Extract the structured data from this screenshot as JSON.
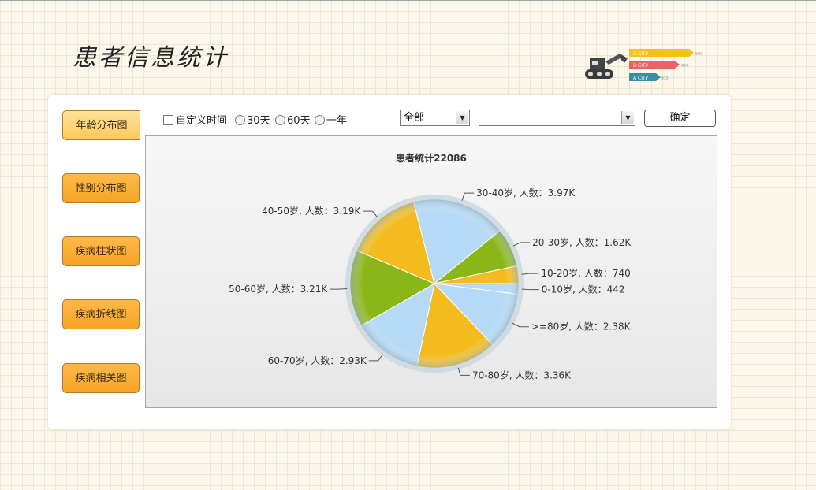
{
  "page": {
    "title": "患者信息统计"
  },
  "logo": {
    "bars": [
      {
        "label": "C CITY",
        "value": "500",
        "color": "#f5c21b"
      },
      {
        "label": "B CITY",
        "value": "400",
        "color": "#e86363"
      },
      {
        "label": "A CITY",
        "value": "300",
        "color": "#3d8ea1"
      }
    ]
  },
  "sidebar": {
    "items": [
      {
        "label": "年龄分布图",
        "active": true
      },
      {
        "label": "性别分布图",
        "active": false
      },
      {
        "label": "疾病柱状图",
        "active": false
      },
      {
        "label": "疾病折线图",
        "active": false
      },
      {
        "label": "疾病相关图",
        "active": false
      }
    ]
  },
  "filters": {
    "custom_time_label": "自定义时间",
    "radio_30": "30天",
    "radio_60": "60天",
    "radio_year": "一年",
    "select_category": "全部",
    "select_detail": "",
    "confirm_label": "确定"
  },
  "chart_data": {
    "type": "pie",
    "title": "患者统计22086",
    "slices": [
      {
        "label": "0-10岁, 人数：442",
        "value": 442,
        "color": "#b6daf6"
      },
      {
        "label": ">=80岁, 人数：2.38K",
        "value": 2380,
        "color": "#b6daf6"
      },
      {
        "label": "70-80岁, 人数：3.36K",
        "value": 3360,
        "color": "#f4bb1f"
      },
      {
        "label": "60-70岁, 人数：2.93K",
        "value": 2930,
        "color": "#b6daf6"
      },
      {
        "label": "50-60岁, 人数：3.21K",
        "value": 3210,
        "color": "#8bb617"
      },
      {
        "label": "40-50岁, 人数：3.19K",
        "value": 3190,
        "color": "#f4bb1f"
      },
      {
        "label": "30-40岁, 人数：3.97K",
        "value": 3970,
        "color": "#b6daf6"
      },
      {
        "label": "20-30岁, 人数：1.62K",
        "value": 1620,
        "color": "#8bb617"
      },
      {
        "label": "10-20岁, 人数：740",
        "value": 740,
        "color": "#f4bb1f"
      }
    ]
  }
}
